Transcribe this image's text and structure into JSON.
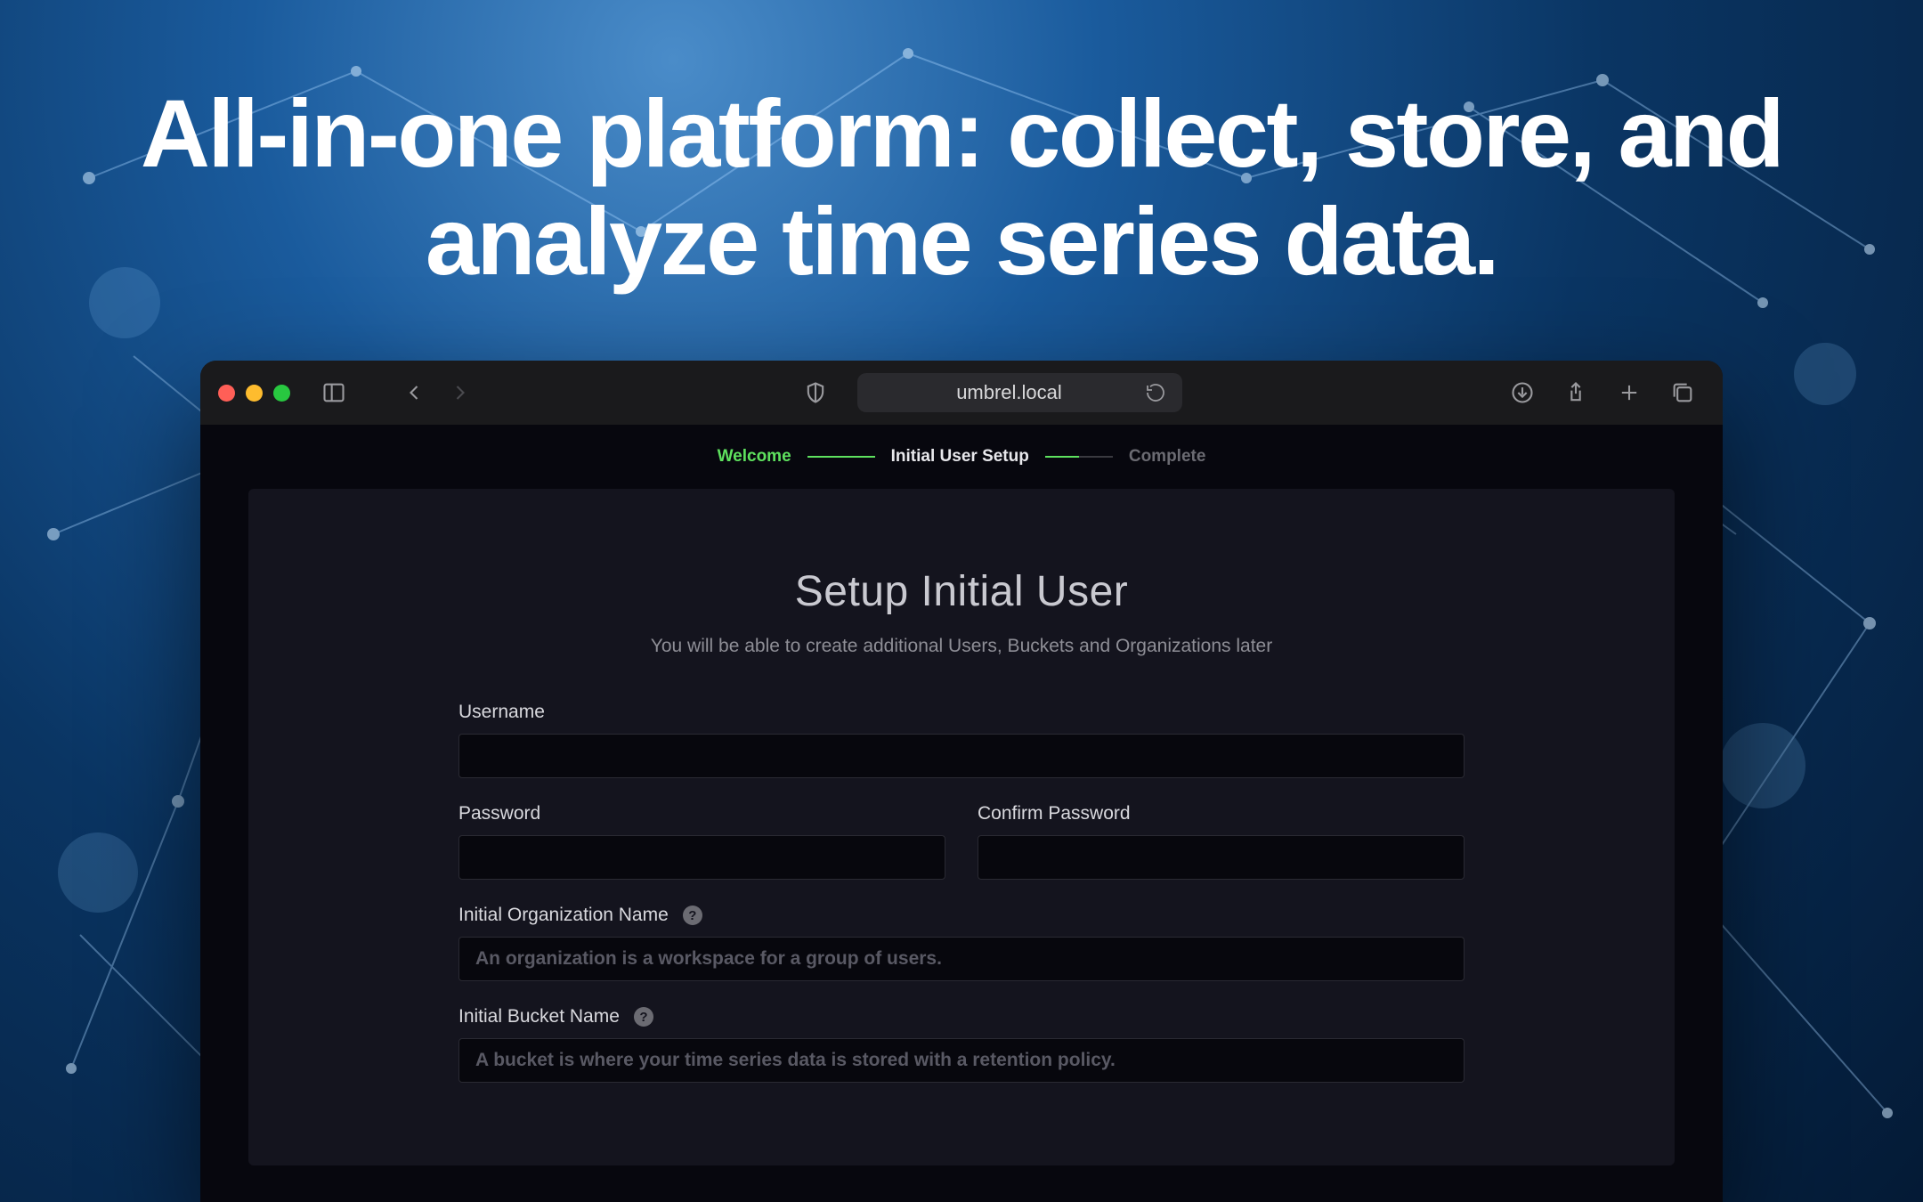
{
  "headline": "All-in-one platform: collect, store, and analyze time series data.",
  "browser": {
    "url": "umbrel.local"
  },
  "stepper": {
    "steps": [
      {
        "label": "Welcome",
        "state": "done"
      },
      {
        "label": "Initial User Setup",
        "state": "active"
      },
      {
        "label": "Complete",
        "state": "pending"
      }
    ]
  },
  "card": {
    "title": "Setup Initial User",
    "subtitle": "You will be able to create additional Users, Buckets and Organizations later"
  },
  "form": {
    "username_label": "Username",
    "username_value": "",
    "password_label": "Password",
    "password_value": "",
    "confirm_label": "Confirm Password",
    "confirm_value": "",
    "org_label": "Initial Organization Name",
    "org_placeholder": "An organization is a workspace for a group of users.",
    "org_value": "",
    "bucket_label": "Initial Bucket Name",
    "bucket_placeholder": "A bucket is where your time series data is stored with a retention policy.",
    "bucket_value": ""
  }
}
